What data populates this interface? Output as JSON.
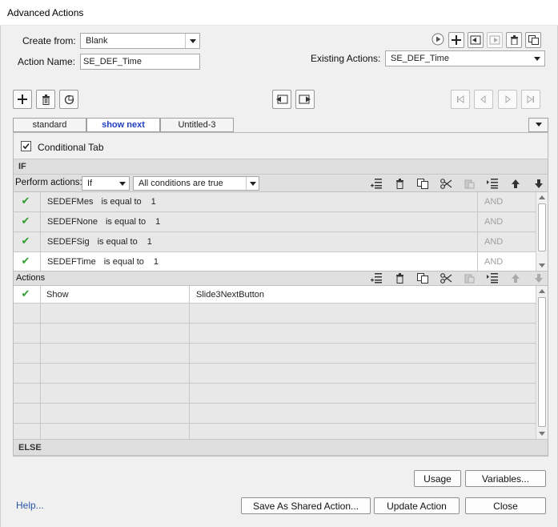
{
  "window": {
    "title": "Advanced Actions"
  },
  "header": {
    "create_from_label": "Create from:",
    "create_from_value": "Blank",
    "action_name_label": "Action Name:",
    "action_name_value": "SE_DEF_Time",
    "existing_actions_label": "Existing Actions:",
    "existing_actions_value": "SE_DEF_Time"
  },
  "tabs": [
    {
      "label": "standard",
      "active": false
    },
    {
      "label": "show next",
      "active": true
    },
    {
      "label": "Untitled-3",
      "active": false
    }
  ],
  "conditional_tab": {
    "label": "Conditional Tab",
    "checked": true
  },
  "if_section": {
    "label": "IF",
    "perform_label": "Perform actions:",
    "perform_value": "If",
    "condition_mode": "All conditions are true",
    "conditions": [
      {
        "variable": "SEDEFMes",
        "operator": "is equal to",
        "value": "1",
        "logic": "AND"
      },
      {
        "variable": "SEDEFNone",
        "operator": "is equal to",
        "value": "1",
        "logic": "AND"
      },
      {
        "variable": "SEDEFSig",
        "operator": "is equal to",
        "value": "1",
        "logic": "AND"
      },
      {
        "variable": "SEDEFTime",
        "operator": "is equal to",
        "value": "1",
        "logic": "AND"
      }
    ]
  },
  "actions_section": {
    "label": "Actions",
    "rows": [
      {
        "action": "Show",
        "target": "Slide3NextButton"
      },
      {
        "action": "",
        "target": ""
      },
      {
        "action": "",
        "target": ""
      },
      {
        "action": "",
        "target": ""
      },
      {
        "action": "",
        "target": ""
      },
      {
        "action": "",
        "target": ""
      },
      {
        "action": "",
        "target": ""
      },
      {
        "action": "",
        "target": ""
      }
    ]
  },
  "else_section": {
    "label": "ELSE"
  },
  "footer": {
    "help_label": "Help...",
    "usage_label": "Usage",
    "variables_label": "Variables...",
    "save_shared_label": "Save As Shared Action...",
    "update_label": "Update Action",
    "close_label": "Close"
  },
  "colors": {
    "accent": "#1f3fbf",
    "check": "#2f9e2f",
    "help_link": "#2855a8"
  }
}
